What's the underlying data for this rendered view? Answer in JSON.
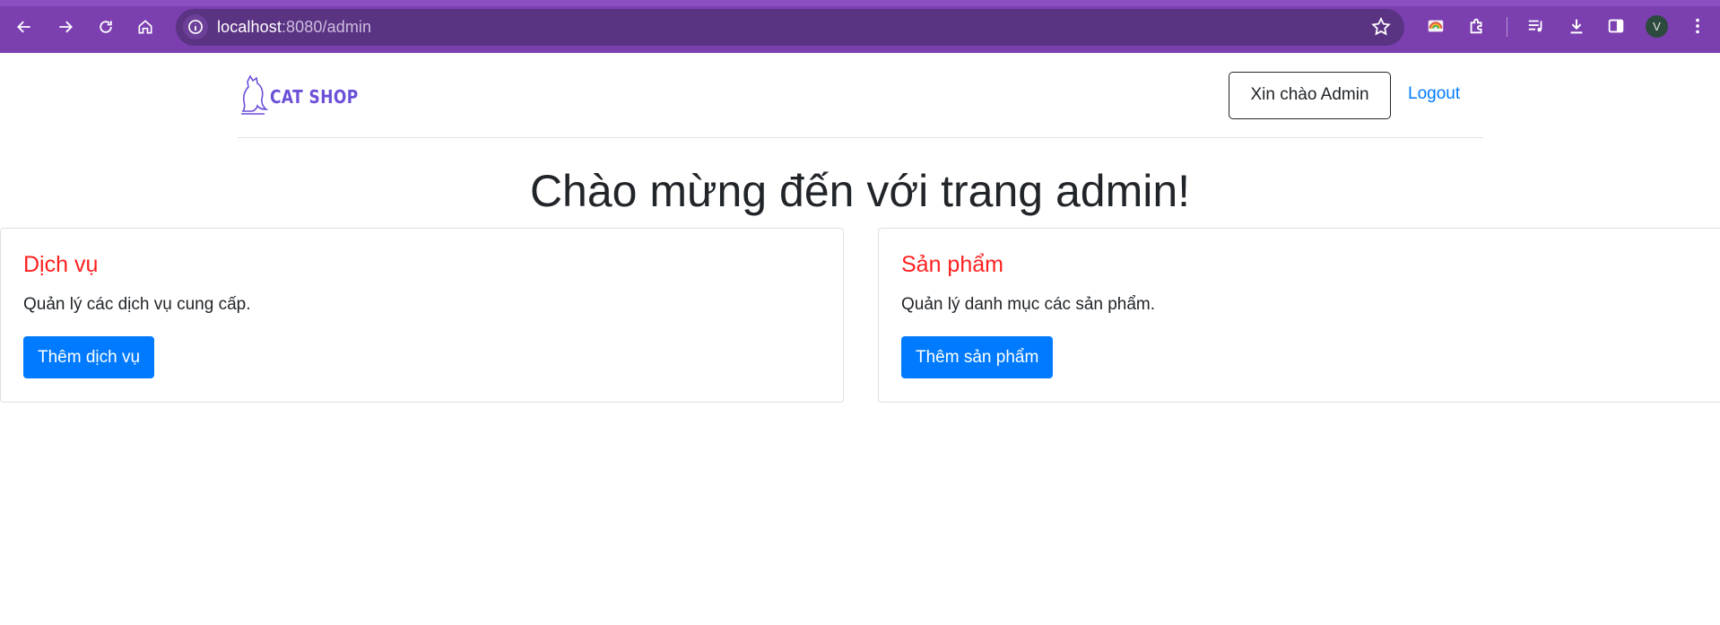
{
  "browser": {
    "url_host": "localhost",
    "url_path": ":8080/admin",
    "profile_initial": "V",
    "icons": [
      "back-icon",
      "forward-icon",
      "reload-icon",
      "home-icon",
      "info-icon",
      "star-icon",
      "color-extension-icon",
      "extensions-icon",
      "media-icon",
      "download-icon",
      "side-panel-icon",
      "menu-icon"
    ]
  },
  "header": {
    "brand": "CAT SHOP",
    "greeting": "Xin chào Admin",
    "logout": "Logout"
  },
  "main": {
    "title": "Chào mừng đến với trang admin!",
    "cards": [
      {
        "title": "Dịch vụ",
        "text": "Quản lý các dịch vụ cung cấp.",
        "button": "Thêm dịch vụ"
      },
      {
        "title": "Sản phẩm",
        "text": "Quản lý danh mục các sản phẩm.",
        "button": "Thêm sản phẩm"
      }
    ]
  },
  "colors": {
    "chrome": "#7b3fb0",
    "card_title": "#ff1f1f",
    "primary": "#007bff",
    "brand": "#6d4fd8"
  }
}
